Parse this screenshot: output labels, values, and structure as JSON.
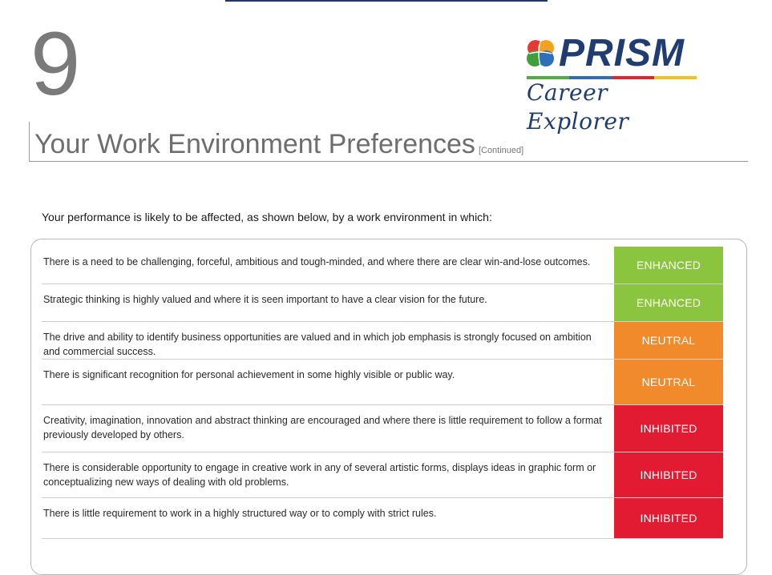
{
  "chapter_number": "9",
  "logo": {
    "word": "PRISM",
    "subtitle": "Career Explorer",
    "bar_colors": [
      "#4caf3f",
      "#2f6fb8",
      "#e3262d",
      "#f2c31b"
    ],
    "brain_colors": [
      "#e53935",
      "#f4a11d",
      "#3fa03a",
      "#2f6fb8"
    ]
  },
  "page_title": "Your Work Environment Preferences",
  "page_title_suffix": "[Continued]",
  "intro": "Your performance is likely to be affected, as shown below, by a work environment in which:",
  "status_colors": {
    "ENHANCED": "#8bc53f",
    "NEUTRAL": "#f08a2b",
    "INHIBITED": "#e21b32"
  },
  "rows": [
    {
      "text": "There is a need to be challenging, forceful, ambitious and tough-minded, and where there are clear win-and-lose outcomes.",
      "status": "ENHANCED"
    },
    {
      "text": "Strategic thinking is highly valued and where it is seen important to have a clear vision for the future.",
      "status": "ENHANCED"
    },
    {
      "text": "The drive and ability to identify business opportunities are valued and in which job emphasis is strongly focused on ambition and commercial success.",
      "status": "NEUTRAL"
    },
    {
      "text": "There is significant recognition for personal achievement in some highly visible or public way.",
      "status": "NEUTRAL"
    },
    {
      "text": "Creativity, imagination, innovation and abstract thinking are encouraged and where there is little requirement to follow a format previously developed by others.",
      "status": "INHIBITED"
    },
    {
      "text": "There is considerable opportunity to engage in creative work in any of several artistic forms, displays ideas in graphic form or conceptualizing new ways of dealing with old problems.",
      "status": "INHIBITED"
    },
    {
      "text": "There is little requirement to work in a highly structured way or to comply with strict rules.",
      "status": "INHIBITED"
    }
  ]
}
